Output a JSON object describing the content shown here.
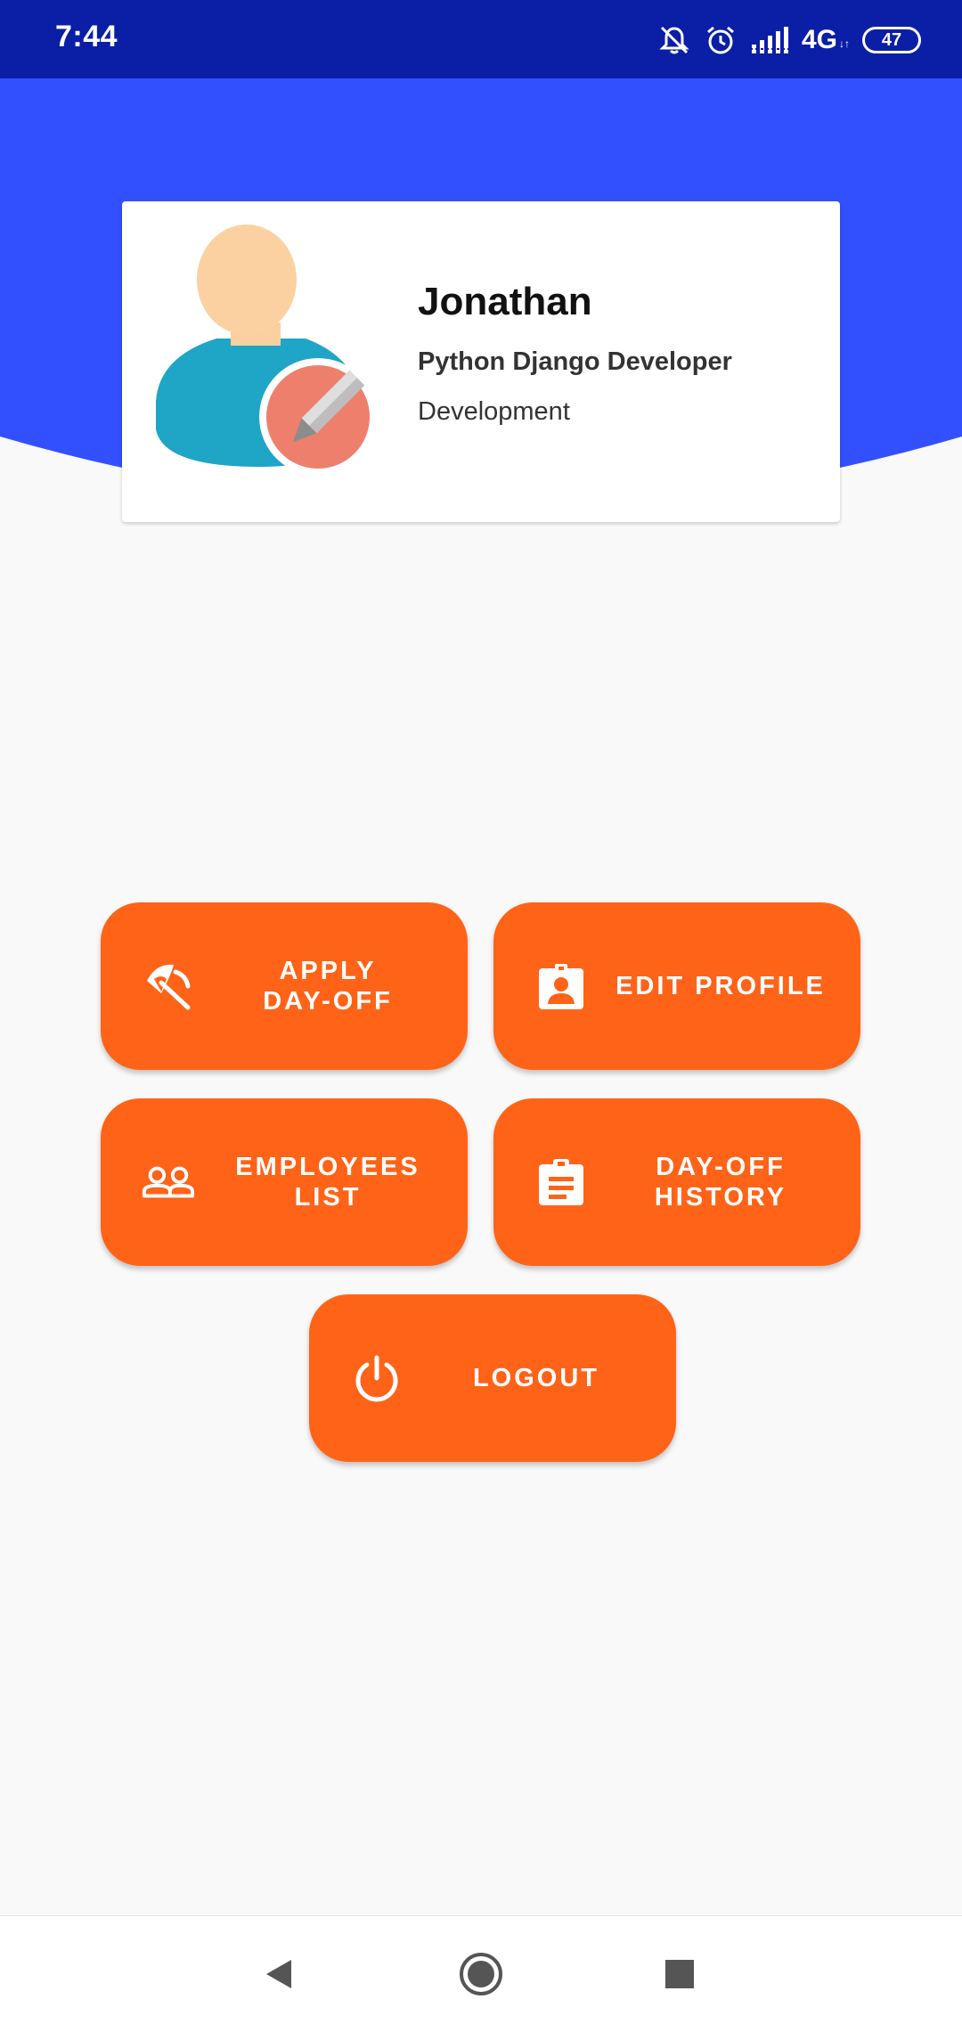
{
  "status_bar": {
    "time": "7:44",
    "network": "4G",
    "battery": "47",
    "background_color": "#0a1ea6"
  },
  "header": {
    "color": "#3350ff"
  },
  "profile": {
    "name": "Jonathan",
    "title": "Python Django Developer",
    "department": "Development",
    "avatar_icon": "user-edit-avatar"
  },
  "actions": {
    "accent_color": "#ff6318",
    "apply_day_off": {
      "label": "APPLY\nDAY-OFF",
      "icon": "beach-umbrella-icon"
    },
    "edit_profile": {
      "label": "EDIT PROFILE",
      "icon": "contact-badge-icon"
    },
    "employees_list": {
      "label": "EMPLOYEES\nLIST",
      "icon": "people-icon"
    },
    "day_off_history": {
      "label": "DAY-OFF\nHISTORY",
      "icon": "clipboard-icon"
    },
    "logout": {
      "label": "LOGOUT",
      "icon": "power-icon"
    }
  },
  "nav_bar": {
    "back": "back-triangle-icon",
    "home": "home-circle-icon",
    "recents": "recents-square-icon"
  }
}
